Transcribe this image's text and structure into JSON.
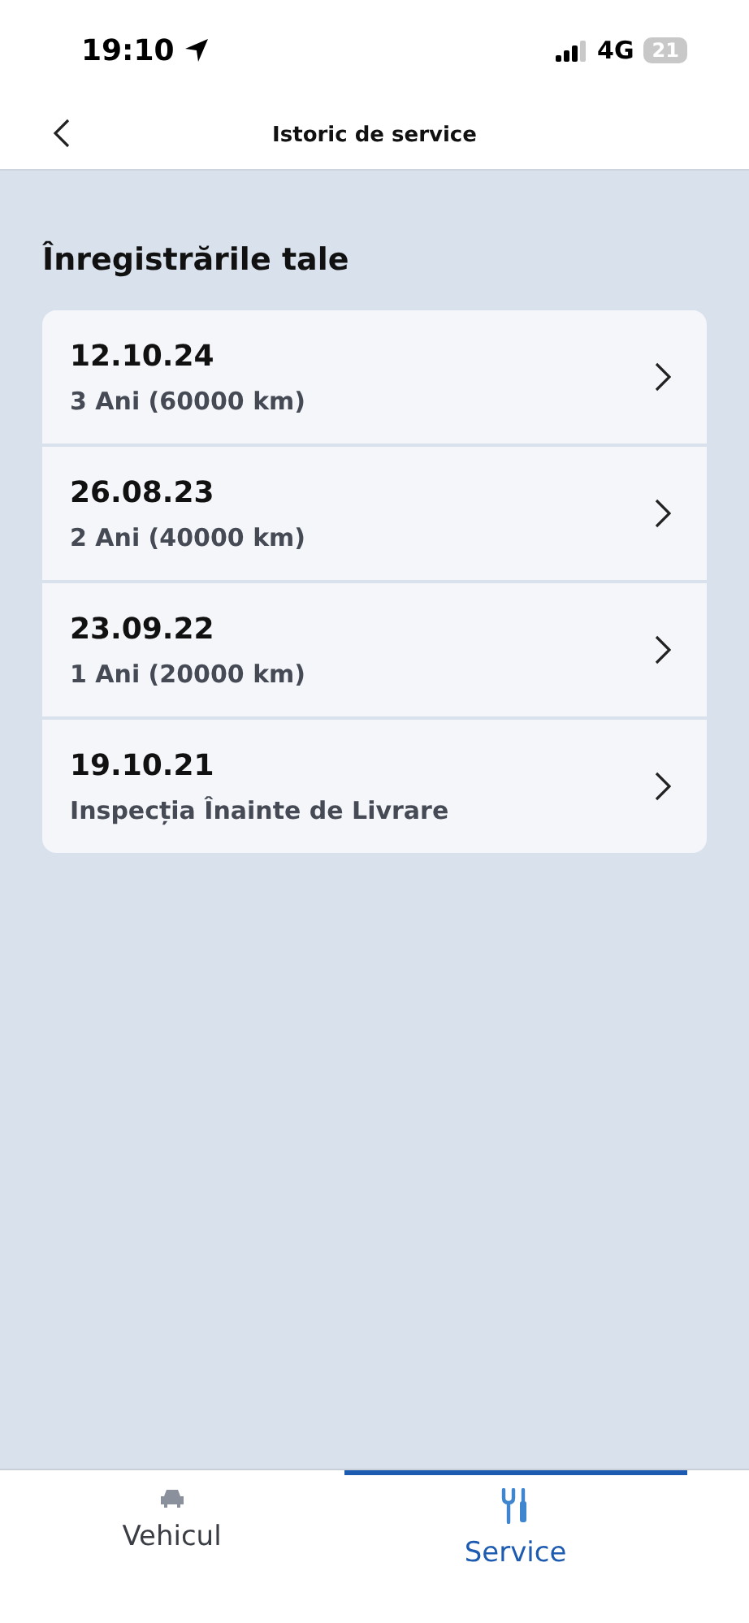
{
  "status_bar": {
    "time": "19:10",
    "network": "4G",
    "battery": "21"
  },
  "nav": {
    "title": "Istoric de service"
  },
  "section_title": "Înregistrările tale",
  "records": [
    {
      "date": "12.10.24",
      "description": "3 Ani (60000 km)"
    },
    {
      "date": "26.08.23",
      "description": "2 Ani (40000 km)"
    },
    {
      "date": "23.09.22",
      "description": "1 Ani (20000 km)"
    },
    {
      "date": "19.10.21",
      "description": "Inspecția Înainte de Livrare"
    }
  ],
  "tabs": [
    {
      "kind": "vehicle",
      "label": "Vehicul",
      "selected": false
    },
    {
      "kind": "service",
      "label": "Service",
      "selected": true
    }
  ]
}
